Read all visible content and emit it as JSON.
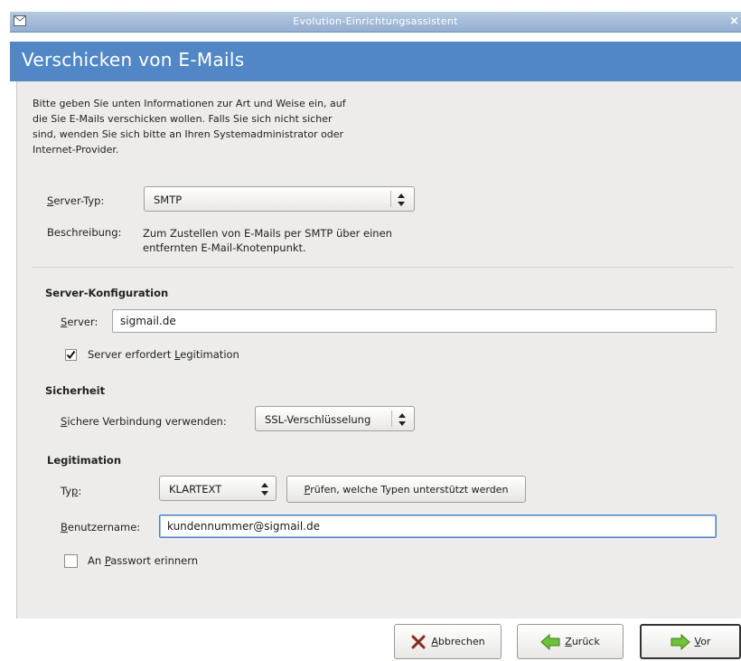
{
  "window": {
    "title": "Evolution-Einrichtungsassistent"
  },
  "page": {
    "heading": "Verschicken von E-Mails",
    "intro": "Bitte geben Sie unten Informationen zur Art und Weise ein, auf die Sie E-Mails verschicken wollen. Falls Sie sich nicht sicher sind, wenden Sie sich bitte an Ihren Systemadministrator oder Internet-Provider."
  },
  "server_type": {
    "label_access_key": "S",
    "label_rest": "erver-Typ:",
    "value": "SMTP",
    "description_label": "Beschreibung:",
    "description": "Zum Zustellen von E-Mails per SMTP über einen entfernten E-Mail-Knotenpunkt."
  },
  "server_config": {
    "heading": "Server-Konfiguration",
    "server_label_key": "S",
    "server_label_rest": "erver:",
    "server_value": "sigmail.de",
    "auth_required_pre": "Server erfordert ",
    "auth_required_key": "L",
    "auth_required_post": "egitimation",
    "auth_required_checked": true
  },
  "security": {
    "heading": "Sicherheit",
    "ssl_label_key": "S",
    "ssl_label_rest": "ichere Verbindung verwenden:",
    "ssl_value": "SSL-Verschlüsselung"
  },
  "auth": {
    "heading": "Legitimation",
    "type_label_pre": "Ty",
    "type_label_key": "p",
    "type_label_post": ":",
    "type_value": "KLARTEXT",
    "check_button_key": "P",
    "check_button_rest": "rüfen, welche Typen unterstützt werden",
    "username_label_key": "B",
    "username_label_rest": "enutzername:",
    "username_value": "kundennummer@sigmail.de",
    "remember_pre": "An ",
    "remember_key": "P",
    "remember_post": "asswort erinnern",
    "remember_checked": false
  },
  "buttons": {
    "cancel_key": "A",
    "cancel_rest": "bbrechen",
    "back_key": "Z",
    "back_rest": "urück",
    "forward_key": "V",
    "forward_rest": "or"
  },
  "colors": {
    "header_band": "#5287c6",
    "panel_bg": "#edeceb",
    "titlebar": "#a8bedb"
  }
}
